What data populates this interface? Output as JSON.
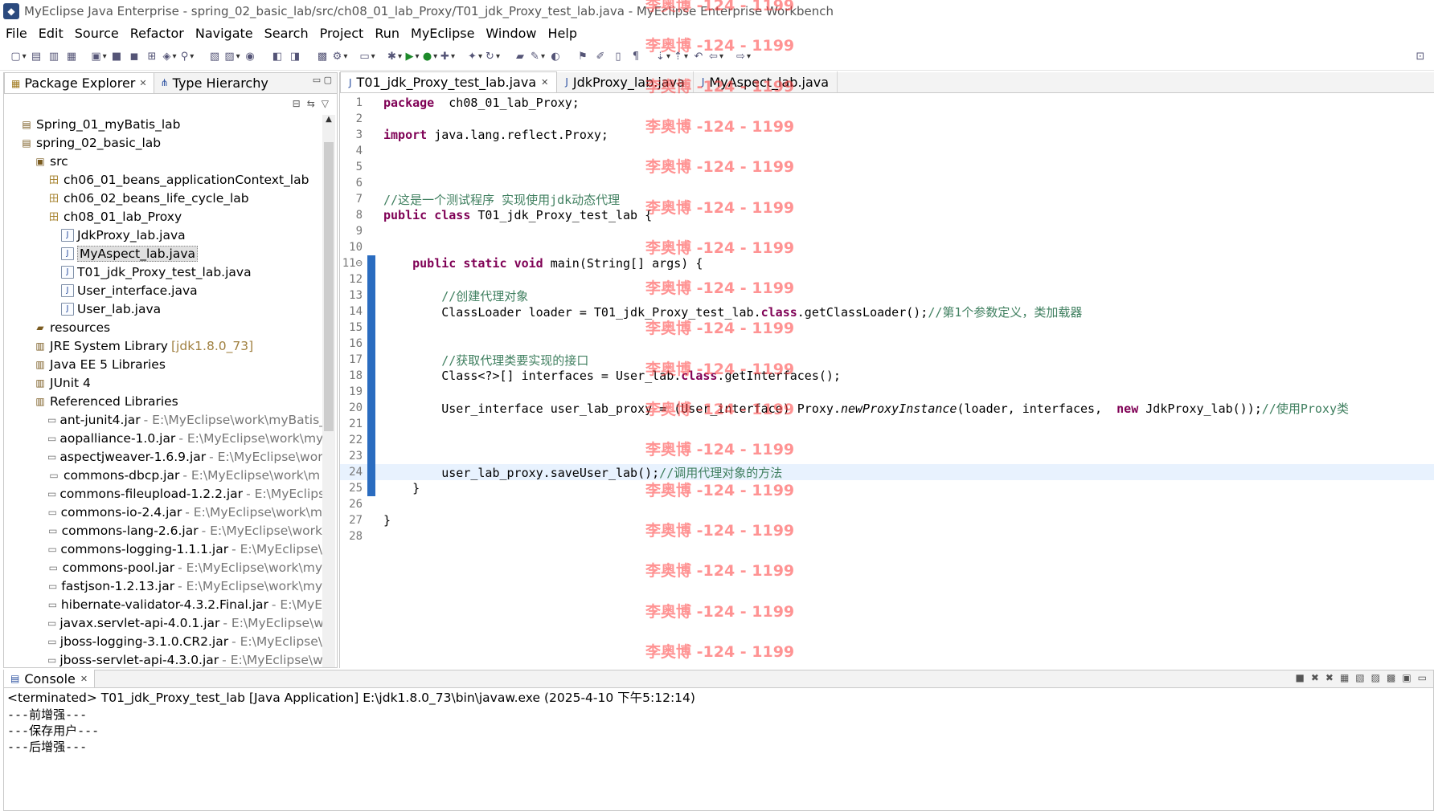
{
  "window": {
    "title": "MyEclipse Java Enterprise - spring_02_basic_lab/src/ch08_01_lab_Proxy/T01_jdk_Proxy_test_lab.java - MyEclipse Enterprise Workbench"
  },
  "menu": [
    "File",
    "Edit",
    "Source",
    "Refactor",
    "Navigate",
    "Search",
    "Project",
    "Run",
    "MyEclipse",
    "Window",
    "Help"
  ],
  "left_panel": {
    "tabs": [
      {
        "label": "Package Explorer",
        "active": true
      },
      {
        "label": "Type Hierarchy",
        "active": false
      }
    ],
    "tree": [
      {
        "indent": 0,
        "icon": "project-icon",
        "label": "Spring_01_myBatis_lab"
      },
      {
        "indent": 0,
        "icon": "project-icon",
        "label": "spring_02_basic_lab"
      },
      {
        "indent": 1,
        "icon": "source-folder-icon",
        "label": "src"
      },
      {
        "indent": 2,
        "icon": "package-icon",
        "label": "ch06_01_beans_applicationContext_lab"
      },
      {
        "indent": 2,
        "icon": "package-icon",
        "label": "ch06_02_beans_life_cycle_lab"
      },
      {
        "indent": 2,
        "icon": "package-icon",
        "label": "ch08_01_lab_Proxy"
      },
      {
        "indent": 3,
        "icon": "java-file-icon",
        "label": "JdkProxy_lab.java"
      },
      {
        "indent": 3,
        "icon": "java-file-icon",
        "label": "MyAspect_lab.java",
        "selected": true
      },
      {
        "indent": 3,
        "icon": "java-file-icon",
        "label": "T01_jdk_Proxy_test_lab.java"
      },
      {
        "indent": 3,
        "icon": "java-file-icon",
        "label": "User_interface.java"
      },
      {
        "indent": 3,
        "icon": "java-file-icon",
        "label": "User_lab.java"
      },
      {
        "indent": 1,
        "icon": "folder-icon",
        "label": "resources"
      },
      {
        "indent": 1,
        "icon": "library-icon",
        "label": "JRE System Library",
        "path": "[jdk1.8.0_73]"
      },
      {
        "indent": 1,
        "icon": "library-icon",
        "label": "Java EE 5 Libraries"
      },
      {
        "indent": 1,
        "icon": "library-icon",
        "label": "JUnit 4"
      },
      {
        "indent": 1,
        "icon": "library-icon",
        "label": "Referenced Libraries"
      },
      {
        "indent": 2,
        "icon": "jar-icon",
        "label": "ant-junit4.jar",
        "path": "- E:\\MyEclipse\\work\\myBatis_"
      },
      {
        "indent": 2,
        "icon": "jar-icon",
        "label": "aopalliance-1.0.jar",
        "path": "- E:\\MyEclipse\\work\\my"
      },
      {
        "indent": 2,
        "icon": "jar-icon",
        "label": "aspectjweaver-1.6.9.jar",
        "path": "- E:\\MyEclipse\\wor"
      },
      {
        "indent": 2,
        "icon": "jar-icon",
        "label": "commons-dbcp.jar",
        "path": "- E:\\MyEclipse\\work\\m"
      },
      {
        "indent": 2,
        "icon": "jar-icon",
        "label": "commons-fileupload-1.2.2.jar",
        "path": "- E:\\MyEclips"
      },
      {
        "indent": 2,
        "icon": "jar-icon",
        "label": "commons-io-2.4.jar",
        "path": "- E:\\MyEclipse\\work\\m"
      },
      {
        "indent": 2,
        "icon": "jar-icon",
        "label": "commons-lang-2.6.jar",
        "path": "- E:\\MyEclipse\\work"
      },
      {
        "indent": 2,
        "icon": "jar-icon",
        "label": "commons-logging-1.1.1.jar",
        "path": "- E:\\MyEclipse\\"
      },
      {
        "indent": 2,
        "icon": "jar-icon",
        "label": "commons-pool.jar",
        "path": "- E:\\MyEclipse\\work\\my"
      },
      {
        "indent": 2,
        "icon": "jar-icon",
        "label": "fastjson-1.2.13.jar",
        "path": "- E:\\MyEclipse\\work\\my"
      },
      {
        "indent": 2,
        "icon": "jar-icon",
        "label": "hibernate-validator-4.3.2.Final.jar",
        "path": "- E:\\MyE"
      },
      {
        "indent": 2,
        "icon": "jar-icon",
        "label": "javax.servlet-api-4.0.1.jar",
        "path": "- E:\\MyEclipse\\w"
      },
      {
        "indent": 2,
        "icon": "jar-icon",
        "label": "jboss-logging-3.1.0.CR2.jar",
        "path": "- E:\\MyEclipse\\"
      },
      {
        "indent": 2,
        "icon": "jar-icon",
        "label": "jboss-servlet-api-4.3.0.jar",
        "path": "- E:\\MyEclipse\\w"
      }
    ]
  },
  "editor": {
    "tabs": [
      {
        "label": "T01_jdk_Proxy_test_lab.java",
        "active": true
      },
      {
        "label": "JdkProxy_lab.java",
        "active": false
      },
      {
        "label": "MyAspect_lab.java",
        "active": false
      }
    ],
    "lines": [
      {
        "n": "1",
        "parts": [
          [
            "kw",
            "package"
          ],
          [
            "",
            "  ch08_01_lab_Proxy;"
          ]
        ]
      },
      {
        "n": "2",
        "parts": []
      },
      {
        "n": "3",
        "parts": [
          [
            "kw",
            "import"
          ],
          [
            "",
            " java.lang.reflect.Proxy;"
          ]
        ]
      },
      {
        "n": "4",
        "parts": []
      },
      {
        "n": "5",
        "parts": []
      },
      {
        "n": "6",
        "parts": []
      },
      {
        "n": "7",
        "parts": [
          [
            "cm",
            "//这是一个测试程序 实现使用jdk动态代理"
          ]
        ]
      },
      {
        "n": "8",
        "parts": [
          [
            "kw",
            "public"
          ],
          [
            "",
            " "
          ],
          [
            "kw",
            "class"
          ],
          [
            "",
            " T01_jdk_Proxy_test_lab {"
          ]
        ]
      },
      {
        "n": "9",
        "parts": []
      },
      {
        "n": "10",
        "parts": []
      },
      {
        "n": "11⊖",
        "mark": true,
        "parts": [
          [
            "",
            "    "
          ],
          [
            "kw",
            "public"
          ],
          [
            "",
            " "
          ],
          [
            "kw",
            "static"
          ],
          [
            "",
            " "
          ],
          [
            "kw",
            "void"
          ],
          [
            "",
            " main(String[] args) {"
          ]
        ]
      },
      {
        "n": "12",
        "mark": true,
        "parts": []
      },
      {
        "n": "13",
        "mark": true,
        "parts": [
          [
            "",
            "        "
          ],
          [
            "cm",
            "//创建代理对象"
          ]
        ]
      },
      {
        "n": "14",
        "mark": true,
        "parts": [
          [
            "",
            "        ClassLoader loader = T01_jdk_Proxy_test_lab."
          ],
          [
            "kw",
            "class"
          ],
          [
            "",
            ".getClassLoader();"
          ],
          [
            "cm",
            "//第1个参数定义，类加载器"
          ]
        ]
      },
      {
        "n": "15",
        "mark": true,
        "parts": []
      },
      {
        "n": "16",
        "mark": true,
        "parts": []
      },
      {
        "n": "17",
        "mark": true,
        "parts": [
          [
            "",
            "        "
          ],
          [
            "cm",
            "//获取代理类要实现的接口"
          ]
        ]
      },
      {
        "n": "18",
        "mark": true,
        "parts": [
          [
            "",
            "        Class<?>[] interfaces = User_lab."
          ],
          [
            "kw",
            "class"
          ],
          [
            "",
            ".getInterfaces();"
          ]
        ]
      },
      {
        "n": "19",
        "mark": true,
        "parts": []
      },
      {
        "n": "20",
        "mark": true,
        "parts": [
          [
            "",
            "        User_interface user_lab_proxy = (User_interface) Proxy."
          ],
          [
            "it",
            "newProxyInstance"
          ],
          [
            "",
            "(loader, interfaces,  "
          ],
          [
            "kw",
            "new"
          ],
          [
            "",
            " JdkProxy_lab());"
          ],
          [
            "cm",
            "//使用Proxy类"
          ]
        ]
      },
      {
        "n": "21",
        "mark": true,
        "parts": []
      },
      {
        "n": "22",
        "mark": true,
        "parts": []
      },
      {
        "n": "23",
        "mark": true,
        "parts": []
      },
      {
        "n": "24",
        "mark": true,
        "cur": true,
        "parts": [
          [
            "",
            "        user_lab_proxy.saveUser_lab();"
          ],
          [
            "cm",
            "//调用代理对象的方法"
          ]
        ]
      },
      {
        "n": "25",
        "mark": true,
        "parts": [
          [
            "",
            "    }"
          ]
        ]
      },
      {
        "n": "26",
        "parts": []
      },
      {
        "n": "27",
        "parts": [
          [
            "",
            "}"
          ]
        ]
      },
      {
        "n": "28",
        "parts": []
      }
    ]
  },
  "console": {
    "tab": "Console",
    "status": "<terminated> T01_jdk_Proxy_test_lab [Java Application] E:\\jdk1.8.0_73\\bin\\javaw.exe (2025-4-10 下午5:12:14)",
    "output": [
      "---前增强---",
      "---保存用户---",
      "---后增强---"
    ]
  },
  "watermark": {
    "text": "李奥博 -124 - 1199",
    "count": 17
  }
}
